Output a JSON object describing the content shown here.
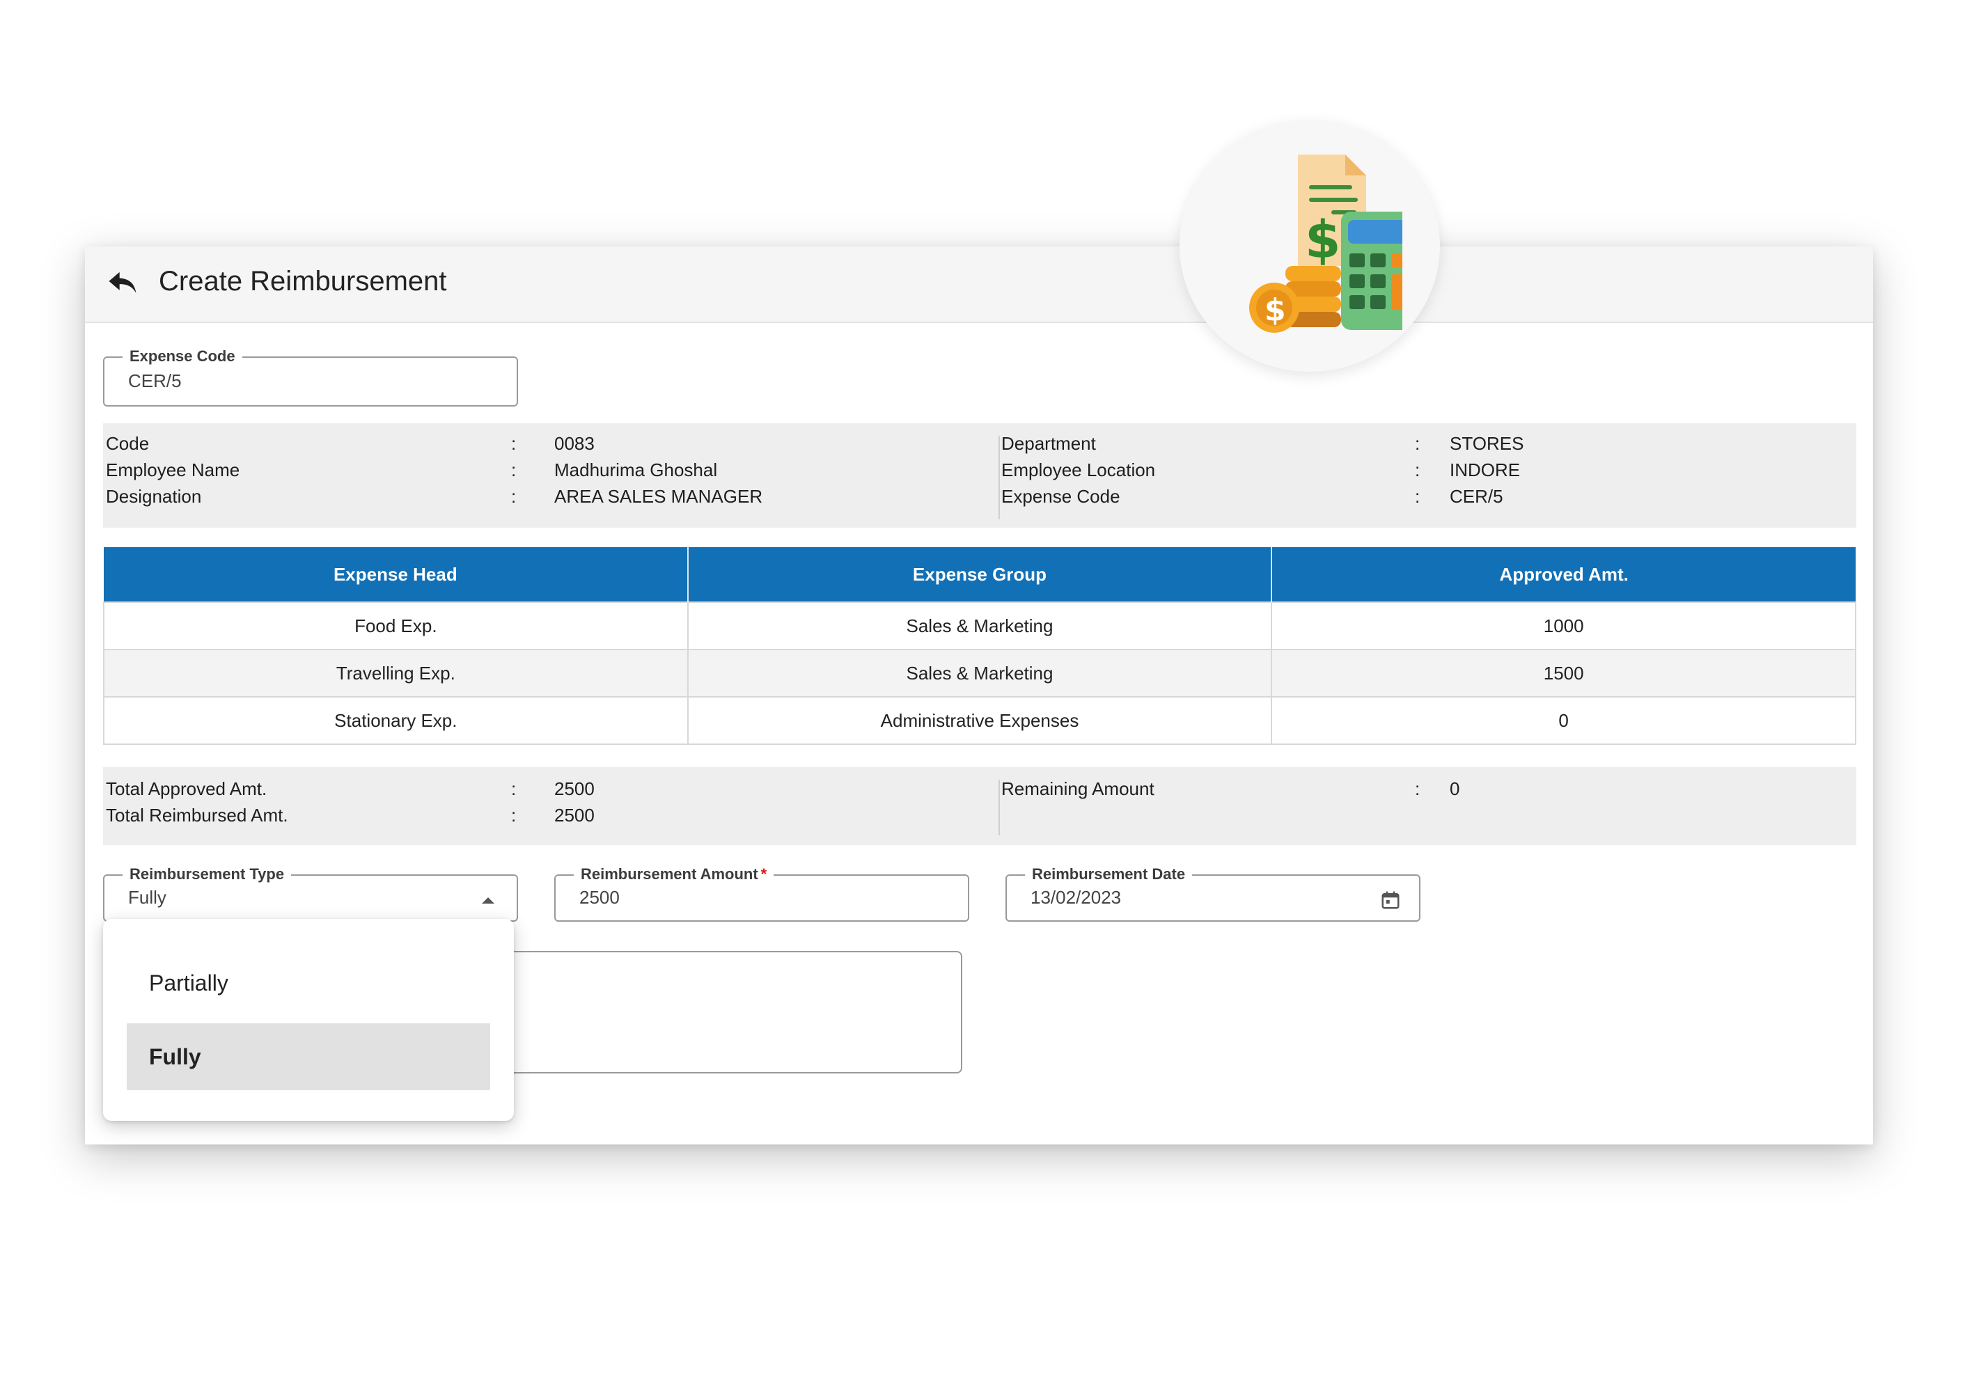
{
  "header": {
    "title": "Create Reimbursement",
    "back_icon": "back-arrow-icon"
  },
  "badge": {
    "icon": "reimbursement-calculator-icon"
  },
  "expense_code_field": {
    "label": "Expense Code",
    "value": "CER/5"
  },
  "employee_info": {
    "left": [
      {
        "label": "Code",
        "colon": ":",
        "value": "0083"
      },
      {
        "label": "Employee Name",
        "colon": ":",
        "value": "Madhurima Ghoshal"
      },
      {
        "label": "Designation",
        "colon": ":",
        "value": "AREA SALES MANAGER"
      }
    ],
    "right": [
      {
        "label": "Department",
        "colon": ":",
        "value": "STORES"
      },
      {
        "label": "Employee Location",
        "colon": ":",
        "value": "INDORE"
      },
      {
        "label": "Expense Code",
        "colon": ":",
        "value": "CER/5"
      }
    ]
  },
  "expense_table": {
    "columns": [
      "Expense Head",
      "Expense Group",
      "Approved Amt."
    ],
    "rows": [
      [
        "Food Exp.",
        "Sales & Marketing",
        "1000"
      ],
      [
        "Travelling Exp.",
        "Sales & Marketing",
        "1500"
      ],
      [
        "Stationary Exp.",
        "Administrative Expenses",
        "0"
      ]
    ],
    "header_color": "#1170b6"
  },
  "totals": {
    "left": [
      {
        "label": "Total Approved Amt.",
        "colon": ":",
        "value": "2500"
      },
      {
        "label": "Total Reimbursed Amt.",
        "colon": ":",
        "value": "2500"
      }
    ],
    "right": [
      {
        "label": "Remaining Amount",
        "colon": ":",
        "value": "0"
      }
    ]
  },
  "reimbursement_type": {
    "label": "Reimbursement Type",
    "value": "Fully",
    "options": [
      "Partially",
      "Fully"
    ],
    "selected": "Fully"
  },
  "reimbursement_amount": {
    "label": "Reimbursement Amount",
    "required_mark": "*",
    "value": "2500"
  },
  "reimbursement_date": {
    "label": "Reimbursement Date",
    "value": "13/02/2023"
  }
}
